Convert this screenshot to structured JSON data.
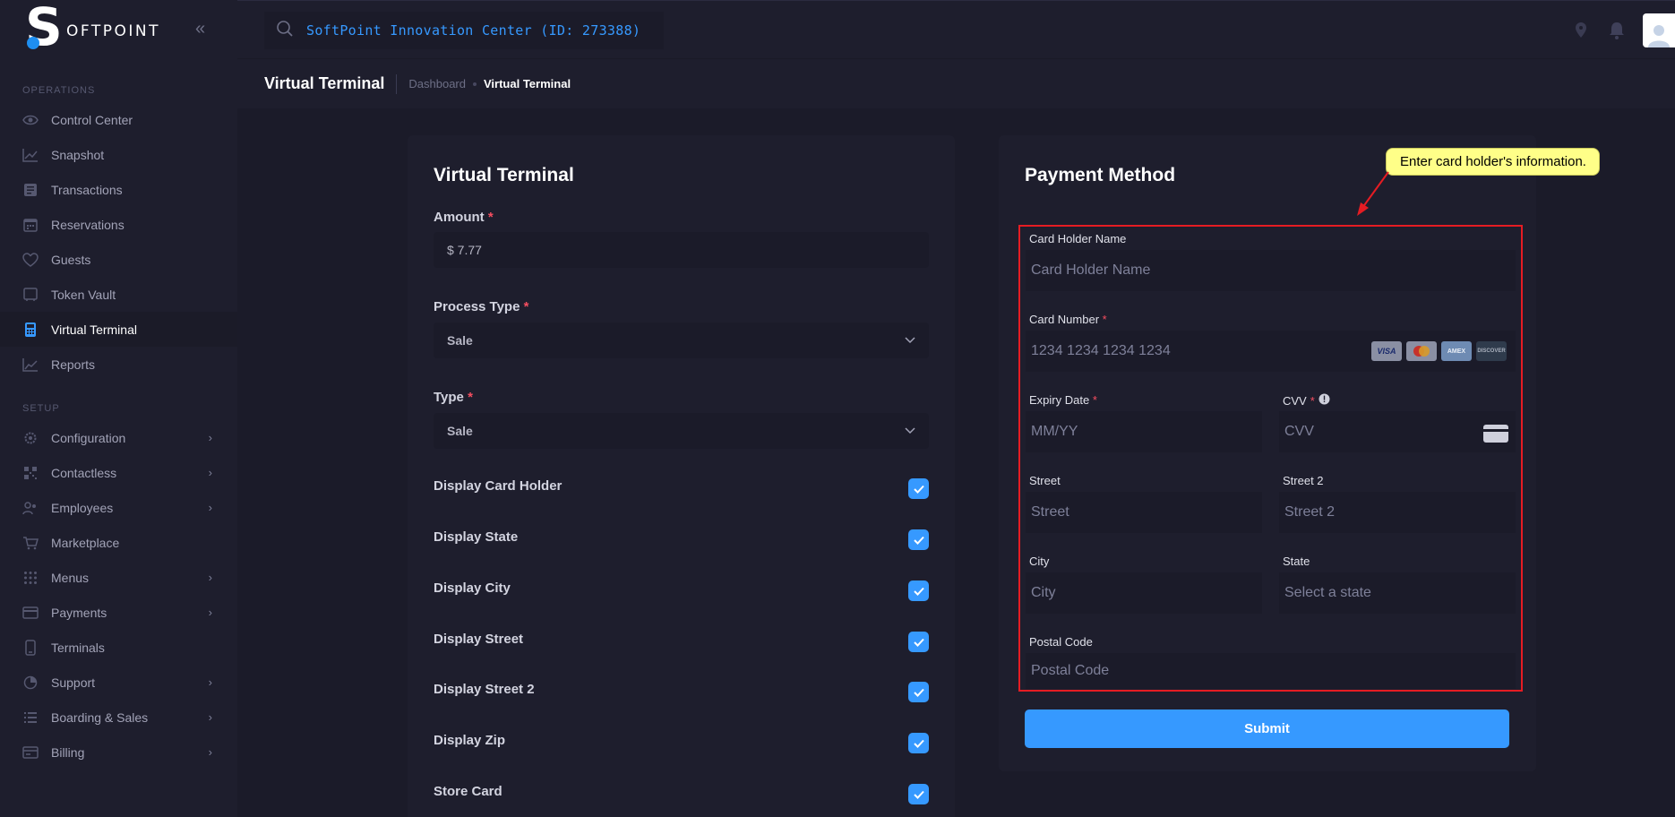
{
  "brand": {
    "logo_letter": "S",
    "logo_text": "OFTPOINT"
  },
  "sidebar": {
    "sections": [
      {
        "title": "OPERATIONS"
      },
      {
        "title": "SETUP"
      }
    ],
    "operations": [
      {
        "label": "Control Center",
        "icon": "eye-icon"
      },
      {
        "label": "Snapshot",
        "icon": "chart-line-icon"
      },
      {
        "label": "Transactions",
        "icon": "receipt-icon"
      },
      {
        "label": "Reservations",
        "icon": "calendar-icon"
      },
      {
        "label": "Guests",
        "icon": "heart-icon"
      },
      {
        "label": "Token Vault",
        "icon": "vault-icon"
      },
      {
        "label": "Virtual Terminal",
        "icon": "terminal-icon",
        "active": true
      },
      {
        "label": "Reports",
        "icon": "chart-icon"
      }
    ],
    "setup": [
      {
        "label": "Configuration",
        "icon": "gear-icon",
        "submenu": true
      },
      {
        "label": "Contactless",
        "icon": "qr-icon",
        "submenu": true
      },
      {
        "label": "Employees",
        "icon": "users-icon",
        "submenu": true
      },
      {
        "label": "Marketplace",
        "icon": "cart-icon",
        "submenu": false
      },
      {
        "label": "Menus",
        "icon": "grid-icon",
        "submenu": true
      },
      {
        "label": "Payments",
        "icon": "card-icon",
        "submenu": true
      },
      {
        "label": "Terminals",
        "icon": "device-icon",
        "submenu": false
      },
      {
        "label": "Support",
        "icon": "pie-icon",
        "submenu": true
      },
      {
        "label": "Boarding & Sales",
        "icon": "list-icon",
        "submenu": true
      },
      {
        "label": "Billing",
        "icon": "billing-icon",
        "submenu": true
      }
    ]
  },
  "topbar": {
    "search_text": "SoftPoint Innovation Center (ID: 273388)"
  },
  "subheader": {
    "title": "Virtual Terminal",
    "breadcrumb": [
      "Dashboard",
      "Virtual Terminal"
    ]
  },
  "left_card": {
    "title": "Virtual Terminal",
    "amount_label": "Amount",
    "amount_value": "$ 7.77",
    "process_type_label": "Process Type",
    "process_type_value": "Sale",
    "type_label": "Type",
    "type_value": "Sale",
    "required_mark": "*",
    "checkboxes": [
      {
        "label": "Display Card Holder",
        "checked": true
      },
      {
        "label": "Display State",
        "checked": true
      },
      {
        "label": "Display City",
        "checked": true
      },
      {
        "label": "Display Street",
        "checked": true
      },
      {
        "label": "Display Street 2",
        "checked": true
      },
      {
        "label": "Display Zip",
        "checked": true
      },
      {
        "label": "Store Card",
        "checked": true
      }
    ]
  },
  "payment": {
    "title": "Payment Method",
    "card_holder_label": "Card Holder Name",
    "card_holder_placeholder": "Card Holder Name",
    "card_number_label": "Card Number",
    "card_number_placeholder": "1234 1234 1234 1234",
    "card_brands": [
      "VISA",
      "MC",
      "AMEX",
      "DISCOVER"
    ],
    "expiry_label": "Expiry Date",
    "expiry_placeholder": "MM/YY",
    "cvv_label": "CVV",
    "cvv_placeholder": "CVV",
    "street_label": "Street",
    "street_placeholder": "Street",
    "street2_label": "Street 2",
    "street2_placeholder": "Street 2",
    "city_label": "City",
    "city_placeholder": "City",
    "state_label": "State",
    "state_placeholder": "Select a state",
    "postal_label": "Postal Code",
    "postal_placeholder": "Postal Code",
    "submit_label": "Submit"
  },
  "annotation": {
    "callout_text": "Enter card holder's information."
  },
  "colors": {
    "accent": "#3699ff",
    "highlight_border": "#e51c23",
    "callout_bg": "#ffff88",
    "required": "#f64e60"
  }
}
